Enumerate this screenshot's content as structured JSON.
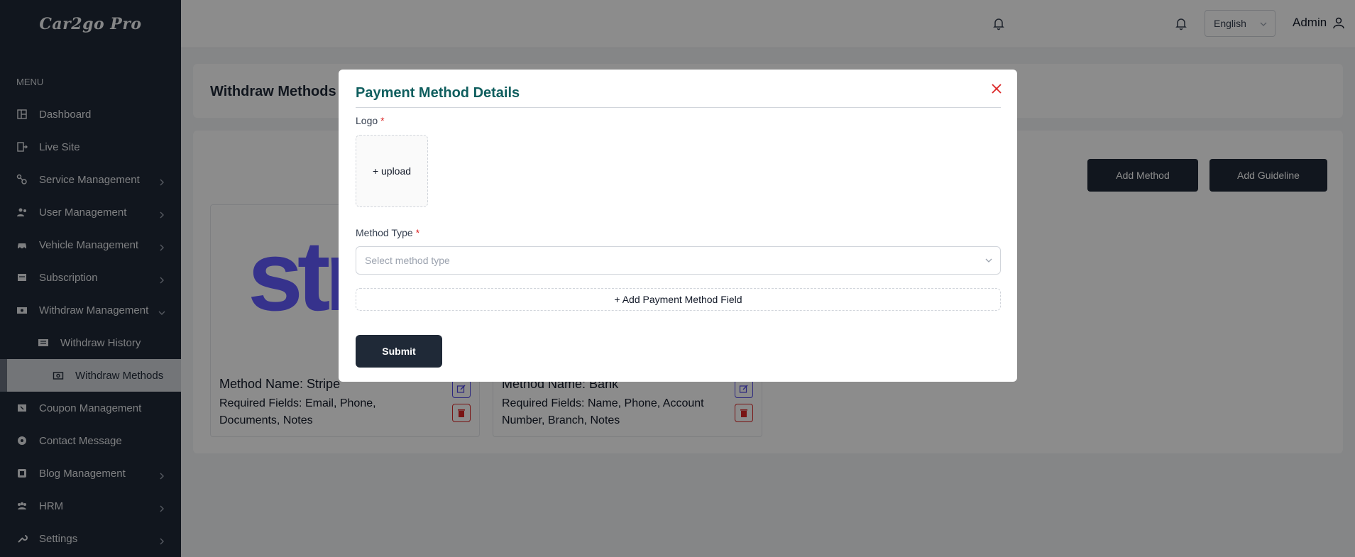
{
  "sidebar": {
    "logo": "Car2go Pro",
    "menu_heading": "MENU",
    "items": [
      {
        "label": "Dashboard",
        "icon": "dashboard-icon"
      },
      {
        "label": "Live Site",
        "icon": "live-site-icon"
      },
      {
        "label": "Service Management",
        "icon": "service-icon"
      },
      {
        "label": "User Management",
        "icon": "users-icon"
      },
      {
        "label": "Vehicle Management",
        "icon": "car-icon"
      },
      {
        "label": "Subscription",
        "icon": "subscription-icon"
      },
      {
        "label": "Withdraw Management",
        "icon": "money-icon"
      },
      {
        "label": "Withdraw History",
        "icon": "list-icon"
      },
      {
        "label": "Withdraw Methods",
        "icon": "money-icon"
      },
      {
        "label": "Coupon Management",
        "icon": "coupon-icon"
      },
      {
        "label": "Contact Message",
        "icon": "message-icon"
      },
      {
        "label": "Blog Management",
        "icon": "blog-icon"
      },
      {
        "label": "HRM",
        "icon": "hrm-icon"
      },
      {
        "label": "Settings",
        "icon": "wrench-icon"
      }
    ]
  },
  "topbar": {
    "language": "English",
    "user": "Admin"
  },
  "page": {
    "title": "Withdraw Methods",
    "add_method_label": "Add Method",
    "add_guideline_label": "Add Guideline"
  },
  "methods": [
    {
      "logo_text": "stripe",
      "name": "Method Name: Stripe",
      "fields": "Required Fields: Email, Phone, Documents, Notes"
    },
    {
      "name": "Method Name: Bank",
      "fields": "Required Fields: Name, Phone, Account Number, Branch, Notes"
    }
  ],
  "modal": {
    "title": "Payment Method Details",
    "logo_label": "Logo",
    "required_mark": "*",
    "upload_label": "+ upload",
    "method_type_label": "Method Type",
    "method_type_placeholder": "Select method type",
    "add_field_label": "+ Add Payment Method Field",
    "submit_label": "Submit"
  },
  "colors": {
    "sidebar_bg": "#1f2937",
    "accent_title": "#0f5e5e",
    "danger": "#dc2626",
    "edit": "#4f46e5",
    "stripe": "#635bff"
  }
}
